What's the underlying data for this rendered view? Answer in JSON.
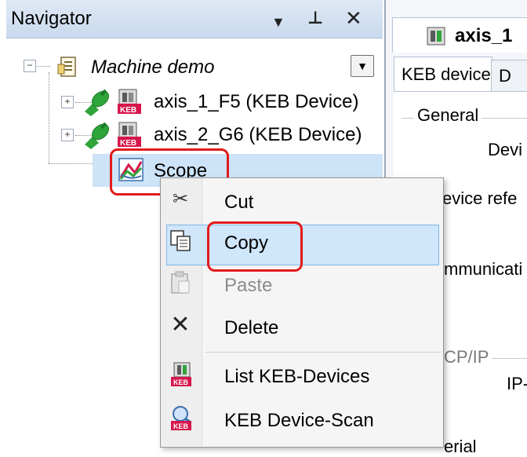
{
  "navigator": {
    "title": "Navigator",
    "pin_glyph": "▾",
    "pin2_glyph": "ᵽ",
    "close_glyph": "✕",
    "tree": {
      "root": {
        "label": "Machine demo",
        "icon": "project-icon",
        "expander": "−"
      },
      "devices": [
        {
          "label": "axis_1_F5 (KEB Device)",
          "icon": "keb-device-icon",
          "expander": "+"
        },
        {
          "label": "axis_2_G6 (KEB Device)",
          "icon": "keb-device-icon",
          "expander": "+"
        }
      ],
      "scope": {
        "label": "Scope",
        "icon": "scope-icon"
      }
    },
    "dropdown_glyph": "▼"
  },
  "editor": {
    "doc_tab": "axis_1",
    "tabs": [
      "KEB device",
      "D"
    ],
    "group_general": "General",
    "device_text": "Devi",
    "device_ref_text": "evice refe",
    "communication_text": "mmunicati",
    "tcpip_text": "CP/IP",
    "ip_text": "IP-",
    "serial_text": "erial"
  },
  "context_menu": {
    "items": [
      {
        "label": "Cut",
        "icon": "scissors-icon",
        "glyph": "✂",
        "enabled": true
      },
      {
        "label": "Copy",
        "icon": "copy-icon",
        "glyph": "⎘",
        "enabled": true,
        "highlighted": true
      },
      {
        "label": "Paste",
        "icon": "paste-icon",
        "glyph": "📋",
        "enabled": false
      },
      {
        "label": "Delete",
        "icon": "delete-icon",
        "glyph": "✕",
        "enabled": true
      },
      {
        "label": "List KEB-Devices",
        "icon": "keb-list-icon",
        "glyph": "",
        "enabled": true
      },
      {
        "label": "KEB Device-Scan",
        "icon": "keb-scan-icon",
        "glyph": "",
        "enabled": true
      }
    ]
  },
  "colors": {
    "highlight": "#cfe6fb",
    "annotation_red": "#e21b1b",
    "keb_red": "#d6164b",
    "plug_green": "#2fa43a"
  }
}
